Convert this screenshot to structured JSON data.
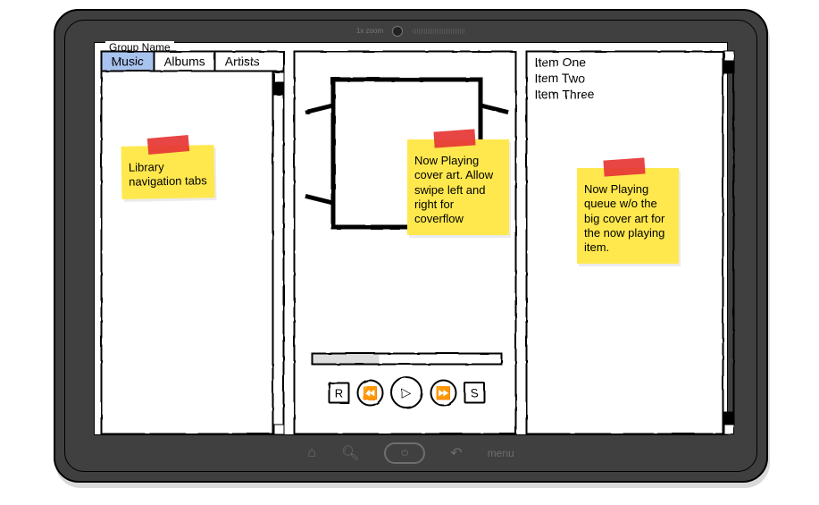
{
  "device": {
    "zoom_hint": "1x zoom",
    "nav": {
      "home": "home-icon",
      "search": "search-icon",
      "power": "power-icon",
      "back": "back-icon",
      "menu": "menu"
    }
  },
  "group_title": "Group Name",
  "tabs": [
    {
      "label": "Music",
      "active": true
    },
    {
      "label": "Albums",
      "active": false
    },
    {
      "label": "Artists",
      "active": false
    }
  ],
  "queue": {
    "items": [
      "Item One",
      "Item Two",
      "Item Three"
    ]
  },
  "player": {
    "progress_pct": 35,
    "controls": {
      "repeat": "R",
      "rewind": "⏪",
      "play": "▷",
      "forward": "⏩",
      "shuffle": "S"
    }
  },
  "notes": {
    "library": "Library navigation tabs",
    "cover": "Now Playing cover art. Allow swipe left and right for coverflow",
    "queue": "Now Playing queue w/o the big cover art for the now playing item."
  }
}
